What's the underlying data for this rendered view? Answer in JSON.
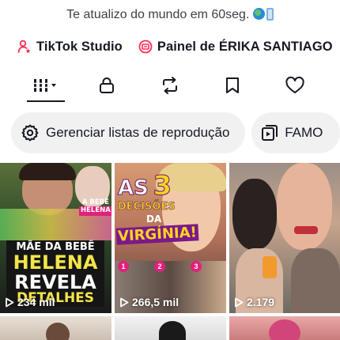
{
  "profile": {
    "bio": "Te atualizo do mundo em 60seg.",
    "bio_emoji_1": "globe-icon",
    "bio_emoji_2": "phone-icon"
  },
  "links": [
    {
      "label": "TikTok Studio",
      "icon": "studio-person-icon"
    },
    {
      "label": "Painel de ÉRIKA SANTIAGO",
      "icon": "creator-panel-icon"
    }
  ],
  "tabs": [
    {
      "name": "videos",
      "icon": "grid-icon",
      "active": true
    },
    {
      "name": "private",
      "icon": "lock-icon",
      "active": false
    },
    {
      "name": "reposts",
      "icon": "repost-icon",
      "active": false
    },
    {
      "name": "favorites",
      "icon": "bookmark-icon",
      "active": false
    },
    {
      "name": "liked",
      "icon": "heart-icon",
      "active": false
    }
  ],
  "chips": [
    {
      "label": "Gerenciar listas de reprodução",
      "icon": "gear-icon"
    },
    {
      "label": "FAMO",
      "icon": "playlist-icon"
    }
  ],
  "videos": [
    {
      "views": "234 mil",
      "headline": [
        "MÃE DA BEBÊ",
        "HELENA",
        "REVELA",
        "DETALHES"
      ],
      "tag": [
        "A BEBÊ",
        "HELENA"
      ]
    },
    {
      "views": "266,5 mil",
      "headline_big": "AS",
      "headline_num": "3",
      "headline_lines": [
        "DECISÕES",
        "DA",
        "VIRGÍNIA!"
      ],
      "badges": [
        "1",
        "2",
        "3"
      ]
    },
    {
      "views": "2.179"
    }
  ],
  "colors": {
    "accent_pink": "#fe2c55",
    "text": "#161823",
    "chip_bg": "#f1f1f2"
  }
}
